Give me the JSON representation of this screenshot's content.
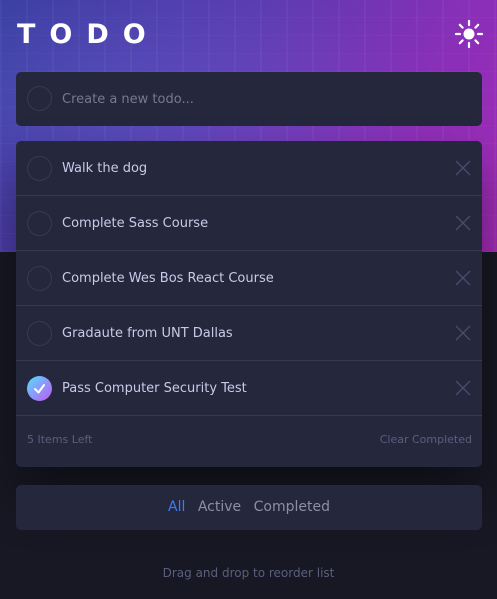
{
  "app": {
    "title": "TODO"
  },
  "theme_toggle": {
    "icon": "sun-icon"
  },
  "new_todo": {
    "placeholder": "Create a new todo..."
  },
  "todos": [
    {
      "text": "Walk the dog",
      "completed": false
    },
    {
      "text": "Complete Sass Course",
      "completed": false
    },
    {
      "text": "Complete Wes Bos React Course",
      "completed": false
    },
    {
      "text": "Gradaute from UNT Dallas",
      "completed": false
    },
    {
      "text": "Pass Computer Security Test",
      "completed": true
    }
  ],
  "footer": {
    "items_left": "5 Items Left",
    "clear_completed": "Clear Completed"
  },
  "filters": {
    "all": "All",
    "active": "Active",
    "completed": "Completed",
    "selected": "All"
  },
  "hint": "Drag and drop to reorder list",
  "colors": {
    "background": "#171823",
    "card": "#25273d",
    "text": "#c8cbe7",
    "muted": "#5b5e7e",
    "accent": "#3a7cfd",
    "check_gradient_start": "#55ddff",
    "check_gradient_end": "#c058f3"
  }
}
